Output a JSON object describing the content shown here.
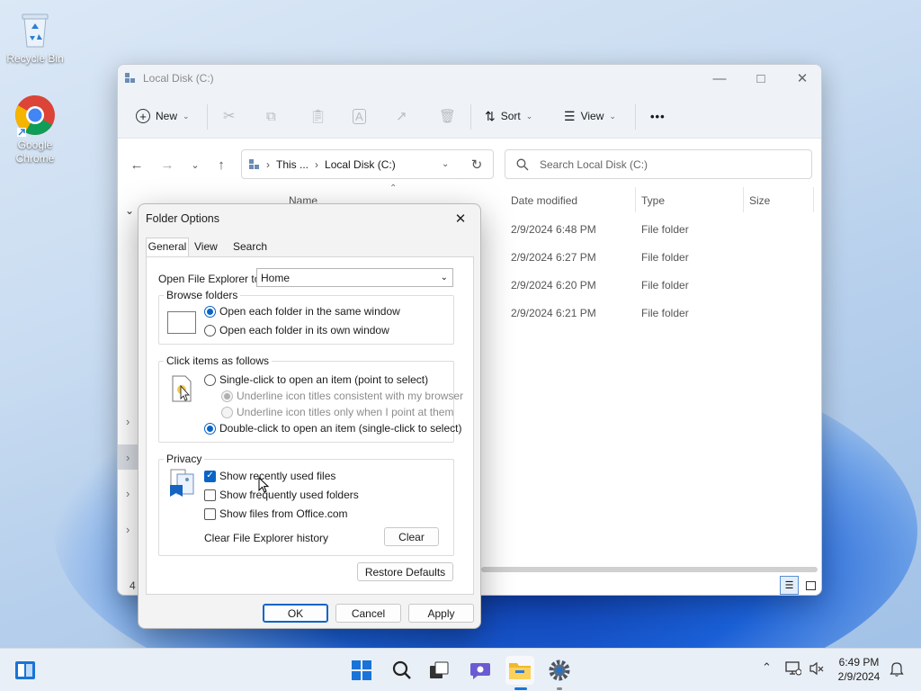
{
  "desktop": {
    "icons": [
      {
        "label": "Recycle Bin",
        "icon": "recycle-bin-icon"
      },
      {
        "label": "Google Chrome",
        "icon": "chrome-icon"
      }
    ]
  },
  "explorer": {
    "title": "Local Disk (C:)",
    "toolbar": {
      "new_label": "New",
      "sort_label": "Sort",
      "view_label": "View",
      "more_label": "•••"
    },
    "address": {
      "crumb1": "This ...",
      "crumb2": "Local Disk (C:)"
    },
    "search": {
      "placeholder": "Search Local Disk (C:)"
    },
    "columns": {
      "name": "Name",
      "date": "Date modified",
      "type": "Type",
      "size": "Size"
    },
    "rows": [
      {
        "date": "2/9/2024 6:48 PM",
        "type": "File folder"
      },
      {
        "date": "2/9/2024 6:27 PM",
        "type": "File folder"
      },
      {
        "date": "2/9/2024 6:20 PM",
        "type": "File folder"
      },
      {
        "date": "2/9/2024 6:21 PM",
        "type": "File folder"
      }
    ],
    "status_count": "4"
  },
  "dialog": {
    "title": "Folder Options",
    "tabs": [
      "General",
      "View",
      "Search"
    ],
    "open_to_label": "Open File Explorer to:",
    "open_to_value": "Home",
    "browse": {
      "title": "Browse folders",
      "same_window": "Open each folder in the same window",
      "own_window": "Open each folder in its own window"
    },
    "click": {
      "title": "Click items as follows",
      "single": "Single-click to open an item (point to select)",
      "underline_browser": "Underline icon titles consistent with my browser",
      "underline_point": "Underline icon titles only when I point at them",
      "double": "Double-click to open an item (single-click to select)"
    },
    "privacy": {
      "title": "Privacy",
      "recent_files": "Show recently used files",
      "frequent_folders": "Show frequently used folders",
      "office_files": "Show files from Office.com",
      "clear_history": "Clear File Explorer history",
      "clear_button": "Clear"
    },
    "restore_defaults": "Restore Defaults",
    "ok": "OK",
    "cancel": "Cancel",
    "apply": "Apply"
  },
  "taskbar": {
    "time": "6:49 PM",
    "date": "2/9/2024"
  },
  "colors": {
    "accent": "#0a64c6"
  }
}
